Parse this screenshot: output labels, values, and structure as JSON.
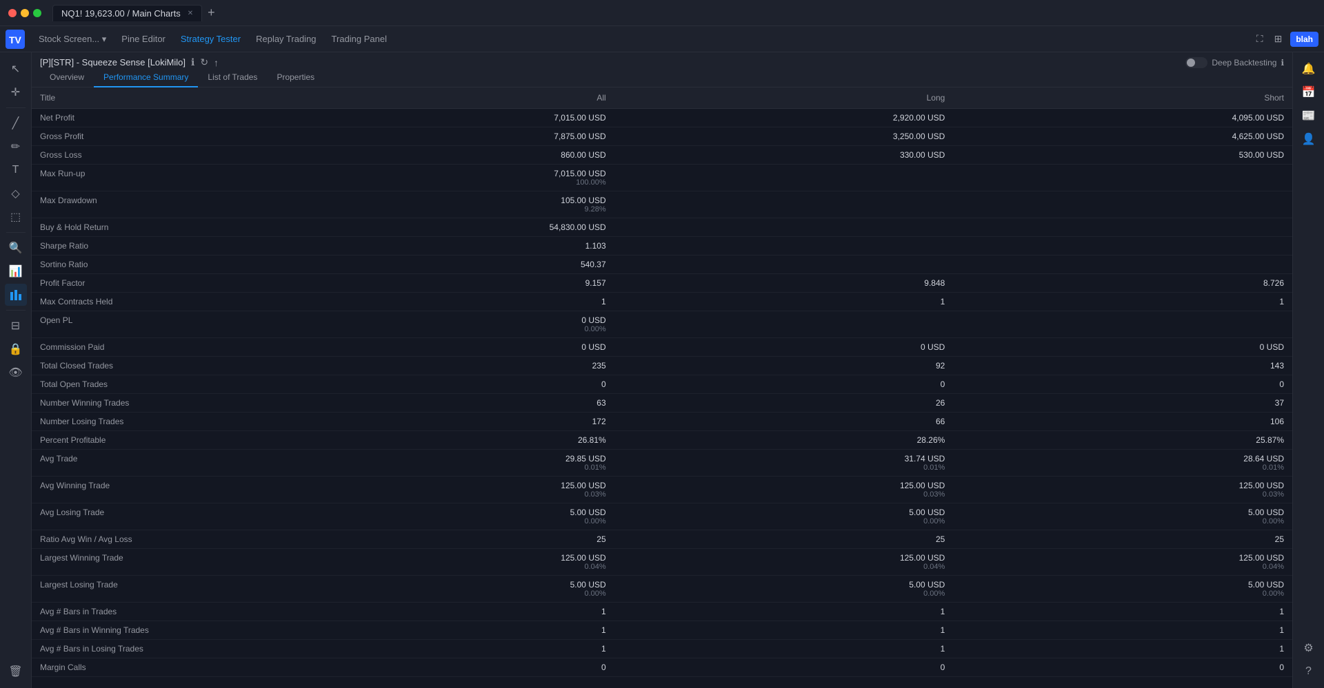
{
  "titlebar": {
    "symbol": "NQ1! 19,623.00",
    "chart": "Main Charts",
    "tab_label": "NQ1! 19,623.00 / Main Charts"
  },
  "navbar": {
    "stock_screener": "Stock Screen...",
    "pine_editor": "Pine Editor",
    "strategy_tester": "Strategy Tester",
    "replay_trading": "Replay Trading",
    "trading_panel": "Trading Panel",
    "right_btn": "blah"
  },
  "panel": {
    "strategy_name": "[P][STR] - Squeeze Sense [LokiMilo]",
    "tabs": [
      "Overview",
      "Performance Summary",
      "List of Trades",
      "Properties"
    ],
    "active_tab": "Performance Summary",
    "deep_backtesting_label": "Deep Backtesting"
  },
  "table": {
    "columns": [
      "Title",
      "All",
      "Long",
      "Short"
    ],
    "rows": [
      {
        "title": "Net Profit",
        "all": "7,015.00 USD",
        "all_sub": "",
        "long": "2,920.00 USD",
        "long_sub": "",
        "short": "4,095.00 USD",
        "short_sub": ""
      },
      {
        "title": "Gross Profit",
        "all": "7,875.00 USD",
        "all_sub": "",
        "long": "3,250.00 USD",
        "long_sub": "",
        "short": "4,625.00 USD",
        "short_sub": ""
      },
      {
        "title": "Gross Loss",
        "all": "860.00 USD",
        "all_sub": "",
        "long": "330.00 USD",
        "long_sub": "",
        "short": "530.00 USD",
        "short_sub": ""
      },
      {
        "title": "Max Run-up",
        "all": "7,015.00 USD",
        "all_sub": "100.00%",
        "long": "",
        "long_sub": "",
        "short": "",
        "short_sub": ""
      },
      {
        "title": "Max Drawdown",
        "all": "105.00 USD",
        "all_sub": "9.28%",
        "long": "",
        "long_sub": "",
        "short": "",
        "short_sub": ""
      },
      {
        "title": "Buy & Hold Return",
        "all": "54,830.00 USD",
        "all_sub": "",
        "long": "",
        "long_sub": "",
        "short": "",
        "short_sub": ""
      },
      {
        "title": "Sharpe Ratio",
        "all": "1.103",
        "all_sub": "",
        "long": "",
        "long_sub": "",
        "short": "",
        "short_sub": ""
      },
      {
        "title": "Sortino Ratio",
        "all": "540.37",
        "all_sub": "",
        "long": "",
        "long_sub": "",
        "short": "",
        "short_sub": ""
      },
      {
        "title": "Profit Factor",
        "all": "9.157",
        "all_sub": "",
        "long": "9.848",
        "long_sub": "",
        "short": "8.726",
        "short_sub": ""
      },
      {
        "title": "Max Contracts Held",
        "all": "1",
        "all_sub": "",
        "long": "1",
        "long_sub": "",
        "short": "1",
        "short_sub": ""
      },
      {
        "title": "Open PL",
        "all": "0 USD",
        "all_sub": "0.00%",
        "long": "",
        "long_sub": "",
        "short": "",
        "short_sub": ""
      },
      {
        "title": "Commission Paid",
        "all": "0 USD",
        "all_sub": "",
        "long": "0 USD",
        "long_sub": "",
        "short": "0 USD",
        "short_sub": ""
      },
      {
        "title": "Total Closed Trades",
        "all": "235",
        "all_sub": "",
        "long": "92",
        "long_sub": "",
        "short": "143",
        "short_sub": ""
      },
      {
        "title": "Total Open Trades",
        "all": "0",
        "all_sub": "",
        "long": "0",
        "long_sub": "",
        "short": "0",
        "short_sub": ""
      },
      {
        "title": "Number Winning Trades",
        "all": "63",
        "all_sub": "",
        "long": "26",
        "long_sub": "",
        "short": "37",
        "short_sub": ""
      },
      {
        "title": "Number Losing Trades",
        "all": "172",
        "all_sub": "",
        "long": "66",
        "long_sub": "",
        "short": "106",
        "short_sub": ""
      },
      {
        "title": "Percent Profitable",
        "all": "26.81%",
        "all_sub": "",
        "long": "28.26%",
        "long_sub": "",
        "short": "25.87%",
        "short_sub": ""
      },
      {
        "title": "Avg Trade",
        "all": "29.85 USD",
        "all_sub": "0.01%",
        "long": "31.74 USD",
        "long_sub": "0.01%",
        "short": "28.64 USD",
        "short_sub": "0.01%"
      },
      {
        "title": "Avg Winning Trade",
        "all": "125.00 USD",
        "all_sub": "0.03%",
        "long": "125.00 USD",
        "long_sub": "0.03%",
        "short": "125.00 USD",
        "short_sub": "0.03%"
      },
      {
        "title": "Avg Losing Trade",
        "all": "5.00 USD",
        "all_sub": "0.00%",
        "long": "5.00 USD",
        "long_sub": "0.00%",
        "short": "5.00 USD",
        "short_sub": "0.00%"
      },
      {
        "title": "Ratio Avg Win / Avg Loss",
        "all": "25",
        "all_sub": "",
        "long": "25",
        "long_sub": "",
        "short": "25",
        "short_sub": ""
      },
      {
        "title": "Largest Winning Trade",
        "all": "125.00 USD",
        "all_sub": "0.04%",
        "long": "125.00 USD",
        "long_sub": "0.04%",
        "short": "125.00 USD",
        "short_sub": "0.04%"
      },
      {
        "title": "Largest Losing Trade",
        "all": "5.00 USD",
        "all_sub": "0.00%",
        "long": "5.00 USD",
        "long_sub": "0.00%",
        "short": "5.00 USD",
        "short_sub": "0.00%"
      },
      {
        "title": "Avg # Bars in Trades",
        "all": "1",
        "all_sub": "",
        "long": "1",
        "long_sub": "",
        "short": "1",
        "short_sub": ""
      },
      {
        "title": "Avg # Bars in Winning Trades",
        "all": "1",
        "all_sub": "",
        "long": "1",
        "long_sub": "",
        "short": "1",
        "short_sub": ""
      },
      {
        "title": "Avg # Bars in Losing Trades",
        "all": "1",
        "all_sub": "",
        "long": "1",
        "long_sub": "",
        "short": "1",
        "short_sub": ""
      },
      {
        "title": "Margin Calls",
        "all": "0",
        "all_sub": "",
        "long": "0",
        "long_sub": "",
        "short": "0",
        "short_sub": ""
      }
    ]
  },
  "left_sidebar_icons": [
    "cursor",
    "crosshair",
    "line",
    "pencil",
    "text",
    "heart",
    "measure",
    "search",
    "chart-bar",
    "layers",
    "lock",
    "eye",
    "strategy"
  ],
  "right_sidebar_icons": [
    "alert",
    "calendar",
    "news",
    "user",
    "settings",
    "trash"
  ],
  "colors": {
    "accent": "#2196f3",
    "bg_dark": "#131722",
    "bg_panel": "#1e222d",
    "border": "#2a2e39",
    "text_primary": "#d1d4dc",
    "text_secondary": "#9598a1",
    "text_muted": "#6b7280"
  }
}
